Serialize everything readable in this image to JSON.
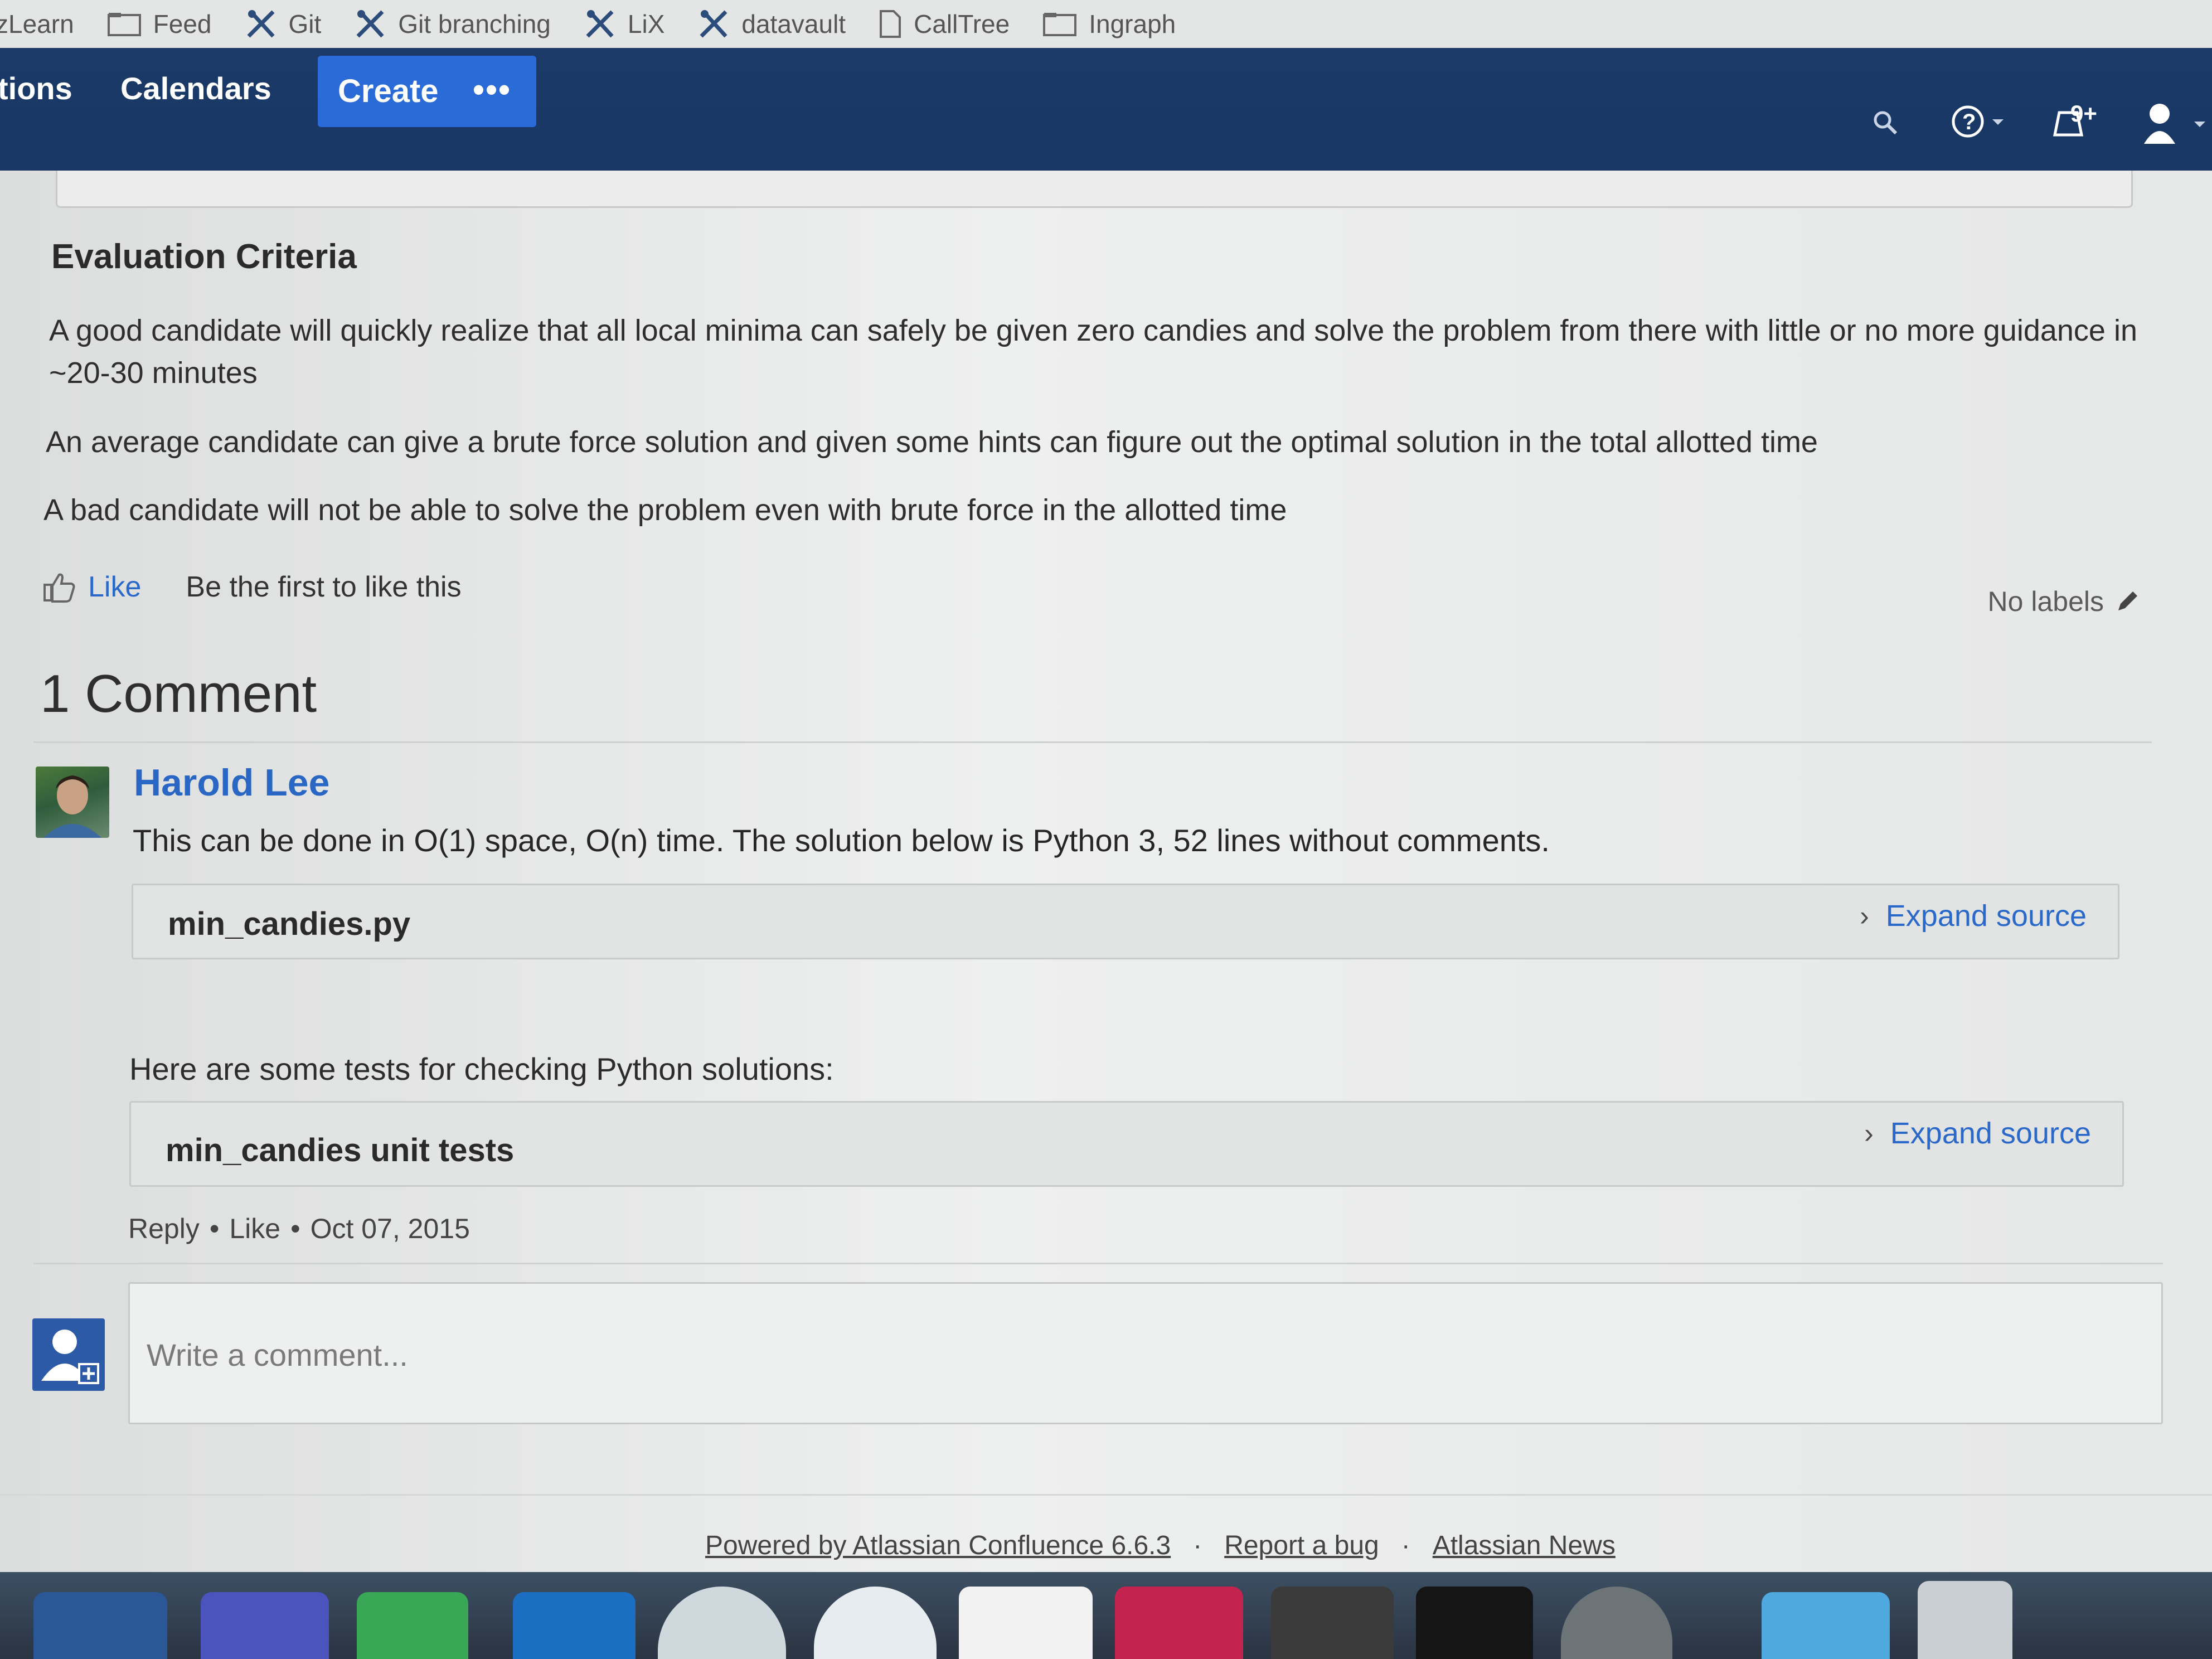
{
  "bookmarks": [
    {
      "label": "zLearn",
      "icon": "none"
    },
    {
      "label": "Feed",
      "icon": "folder-icon"
    },
    {
      "label": "Git",
      "icon": "tool-icon"
    },
    {
      "label": "Git branching",
      "icon": "tool-icon"
    },
    {
      "label": "LiX",
      "icon": "tool-icon"
    },
    {
      "label": "datavault",
      "icon": "tool-icon"
    },
    {
      "label": "CallTree",
      "icon": "page-icon"
    },
    {
      "label": "Ingraph",
      "icon": "folder-icon"
    }
  ],
  "nav": {
    "spaces_partial": "tions",
    "calendars": "Calendars",
    "create": "Create",
    "more": "•••",
    "notifications_badge": "9+"
  },
  "accent_color": "#2a69c9",
  "nav_color": "#1b3a68",
  "content": {
    "heading": "Evaluation Criteria",
    "paragraphs": [
      "A good candidate will quickly realize that all local minima can safely be given zero candies and solve the problem from there with little or no more guidance in ~20-30 minutes",
      "An average candidate can give a brute force solution and given some hints can figure out the optimal solution in the total allotted time",
      "A bad candidate will not be able to solve the problem even with brute force in the allotted time"
    ],
    "like_label": "Like",
    "like_note": "Be the first to like this",
    "labels": "No labels"
  },
  "comments": {
    "heading": "1 Comment",
    "items": [
      {
        "author": "Harold Lee",
        "text": "This can be done in O(1) space, O(n) time. The solution below is Python 3, 52 lines without comments.",
        "code_title": "min_candies.py",
        "expand_label": "Expand source",
        "tests_intro": "Here are some tests for checking Python solutions:",
        "tests_title": "min_candies unit tests",
        "tests_expand_label": "Expand source",
        "reply": "Reply",
        "like": "Like",
        "date": "Oct 07, 2015"
      }
    ],
    "input_placeholder": "Write a comment..."
  },
  "footer": {
    "powered_by": "Powered by Atlassian Confluence 6.6.3",
    "report_bug": "Report a bug",
    "news": "Atlassian News"
  },
  "dock_apps": [
    "word-icon",
    "teams-icon",
    "skype-icon",
    "outlook-icon",
    "chrome-icon",
    "wifi-icon",
    "app-icon",
    "intellij-icon",
    "sublime-icon",
    "terminal-icon",
    "system-preferences-icon",
    "folder-icon",
    "trash-icon"
  ]
}
